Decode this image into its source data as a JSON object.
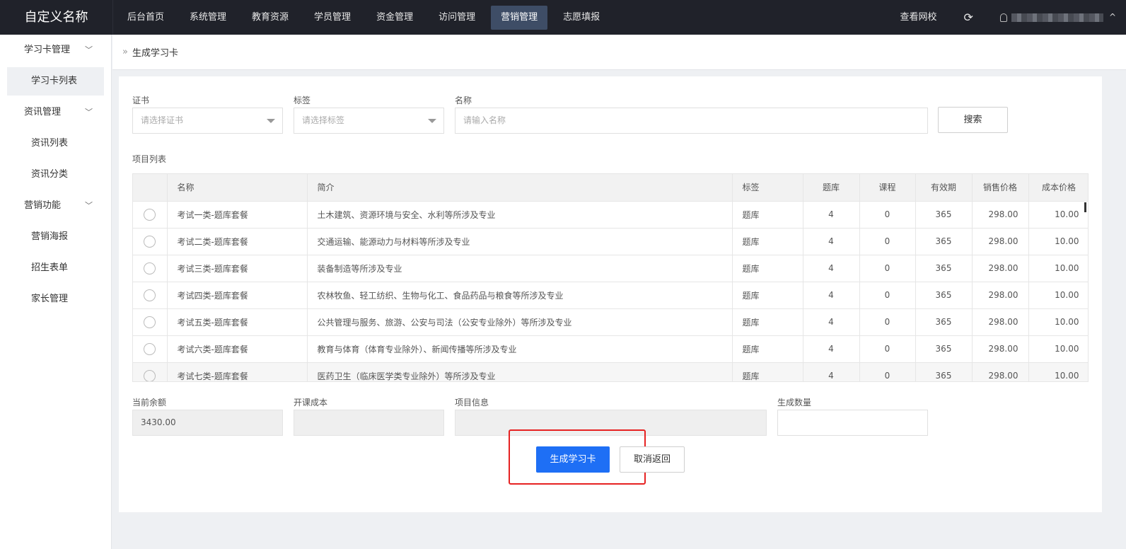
{
  "app": {
    "title": "自定义名称"
  },
  "topnav": [
    "后台首页",
    "系统管理",
    "教育资源",
    "学员管理",
    "资金管理",
    "访问管理",
    "营销管理",
    "志愿填报"
  ],
  "topnav_active": "营销管理",
  "top_right": {
    "view_site": "查看网校",
    "refresh_icon": "⟳",
    "caret": "^"
  },
  "sidebar": {
    "group1": "学习卡管理",
    "item1": "学习卡列表",
    "group2": "资讯管理",
    "item2": "资讯列表",
    "item3": "资讯分类",
    "group3": "营销功能",
    "item4": "营销海报",
    "item5": "招生表单",
    "item6": "家长管理"
  },
  "breadcrumb": {
    "sep": "»",
    "text": "生成学习卡"
  },
  "filters": {
    "cert_label": "证书",
    "cert_placeholder": "请选择证书",
    "tag_label": "标签",
    "tag_placeholder": "请选择标签",
    "name_label": "名称",
    "name_placeholder": "请输入名称",
    "search": "搜索"
  },
  "table": {
    "title": "项目列表",
    "headers": {
      "name": "名称",
      "desc": "简介",
      "tag": "标签",
      "bank": "题库",
      "course": "课程",
      "valid": "有效期",
      "price": "销售价格",
      "cost": "成本价格"
    },
    "rows": [
      {
        "name": "考试一类-题库套餐",
        "desc": "土木建筑、资源环境与安全、水利等所涉及专业",
        "tag": "题库",
        "bank": "4",
        "course": "0",
        "valid": "365",
        "price": "298.00",
        "cost": "10.00"
      },
      {
        "name": "考试二类-题库套餐",
        "desc": "交通运输、能源动力与材料等所涉及专业",
        "tag": "题库",
        "bank": "4",
        "course": "0",
        "valid": "365",
        "price": "298.00",
        "cost": "10.00"
      },
      {
        "name": "考试三类-题库套餐",
        "desc": "装备制造等所涉及专业",
        "tag": "题库",
        "bank": "4",
        "course": "0",
        "valid": "365",
        "price": "298.00",
        "cost": "10.00"
      },
      {
        "name": "考试四类-题库套餐",
        "desc": "农林牧鱼、轻工纺织、生物与化工、食品药品与粮食等所涉及专业",
        "tag": "题库",
        "bank": "4",
        "course": "0",
        "valid": "365",
        "price": "298.00",
        "cost": "10.00"
      },
      {
        "name": "考试五类-题库套餐",
        "desc": "公共管理与服务、旅游、公安与司法（公安专业除外）等所涉及专业",
        "tag": "题库",
        "bank": "4",
        "course": "0",
        "valid": "365",
        "price": "298.00",
        "cost": "10.00"
      },
      {
        "name": "考试六类-题库套餐",
        "desc": "教育与体育（体育专业除外）、新闻传播等所涉及专业",
        "tag": "题库",
        "bank": "4",
        "course": "0",
        "valid": "365",
        "price": "298.00",
        "cost": "10.00"
      },
      {
        "name": "考试七类-题库套餐",
        "desc": "医药卫生（临床医学类专业除外）等所涉及专业",
        "tag": "题库",
        "bank": "4",
        "course": "0",
        "valid": "365",
        "price": "298.00",
        "cost": "10.00"
      }
    ]
  },
  "bottom": {
    "balance_label": "当前余额",
    "balance_value": "3430.00",
    "cost_label": "开课成本",
    "cost_value": "",
    "info_label": "项目信息",
    "info_value": "",
    "qty_label": "生成数量",
    "qty_value": ""
  },
  "actions": {
    "generate": "生成学习卡",
    "cancel": "取消返回"
  },
  "colors": {
    "primary": "#1e6ff5",
    "highlight": "#e62222",
    "topbar": "#20222a"
  }
}
